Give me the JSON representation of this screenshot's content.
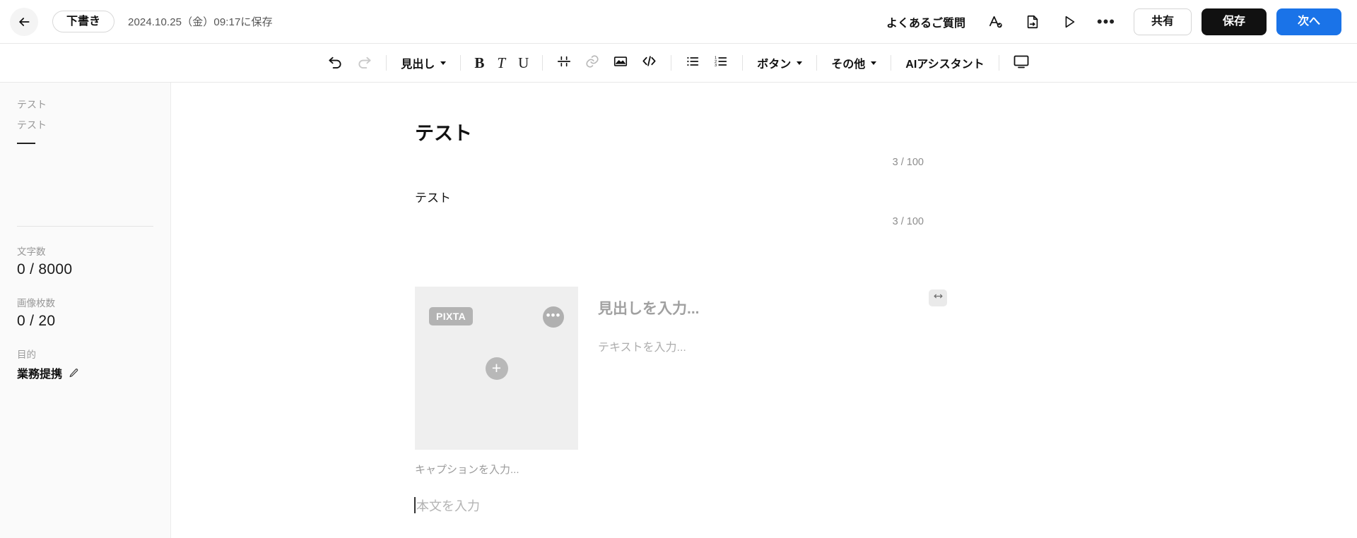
{
  "header": {
    "back_icon": "arrow-left-icon",
    "status_label": "下書き",
    "saved_text": "2024.10.25（金）09:17に保存",
    "faq_label": "よくあるご質問",
    "font_icon": "font-check-icon",
    "export_icon": "file-export-icon",
    "preview_icon": "play-icon",
    "more_icon": "ellipsis-icon",
    "share_label": "共有",
    "save_label": "保存",
    "next_label": "次へ"
  },
  "toolbar": {
    "undo_icon": "undo-icon",
    "redo_icon": "redo-icon",
    "heading_label": "見出し",
    "bold_label": "B",
    "italic_label": "T",
    "underline_label": "U",
    "divider_icon": "horizontal-divider-icon",
    "link_icon": "link-icon",
    "image_icon": "image-icon",
    "code_icon": "code-icon",
    "bullet_list_icon": "bullet-list-icon",
    "number_list_icon": "numbered-list-icon",
    "button_label": "ボタン",
    "other_label": "その他",
    "ai_assistant_label": "AIアシスタント",
    "preview_monitor_icon": "monitor-icon"
  },
  "sidebar": {
    "outline": [
      {
        "label": "テスト"
      },
      {
        "label": "テスト"
      }
    ],
    "stats": [
      {
        "label": "文字数",
        "value": "0 / 8000"
      },
      {
        "label": "画像枚数",
        "value": "0 / 20"
      }
    ],
    "purpose": {
      "label": "目的",
      "value": "業務提携",
      "edit_icon": "pencil-icon"
    }
  },
  "editor": {
    "title": "テスト",
    "title_counter": "3 / 100",
    "subtitle": "テスト",
    "subtitle_counter": "3 / 100",
    "media": {
      "badge": "PIXTA",
      "more_icon": "ellipsis-icon",
      "add_icon": "plus-icon",
      "resize_icon": "resize-horizontal-icon",
      "heading_placeholder": "見出しを入力...",
      "text_placeholder": "テキストを入力...",
      "caption_placeholder": "キャプションを入力..."
    },
    "body_placeholder": "本文を入力"
  },
  "colors": {
    "accent_blue": "#1a73e8",
    "save_black": "#111111",
    "sidebar_bg": "#fafafa",
    "placeholder_gray": "#b4b4b4"
  }
}
